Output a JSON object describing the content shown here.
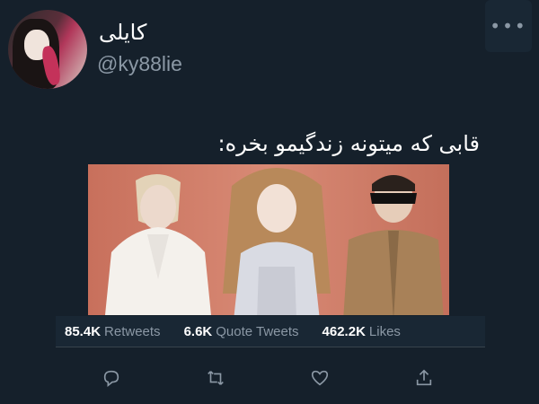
{
  "user": {
    "display_name": "کایلی",
    "handle": "@ky88lie"
  },
  "tweet": {
    "text": "قابی که میتونه زندگیمو بخره:"
  },
  "stats": {
    "retweets_count": "85.4K",
    "retweets_label": "Retweets",
    "quotes_count": "6.6K",
    "quotes_label": "Quote Tweets",
    "likes_count": "462.2K",
    "likes_label": "Likes"
  },
  "icons": {
    "more": "more-icon",
    "reply": "reply-icon",
    "retweet": "retweet-icon",
    "like": "like-icon",
    "share": "share-icon"
  },
  "colors": {
    "background": "#15202b",
    "secondary_text": "#8b98a5"
  }
}
